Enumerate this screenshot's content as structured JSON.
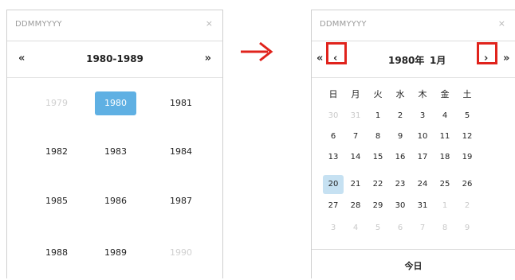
{
  "left_picker": {
    "input_placeholder": "DDMMYYYY",
    "clear": "×",
    "prev": "«",
    "next": "»",
    "decade_title": "1980-1989",
    "years": [
      "1979",
      "1980",
      "1981",
      "1982",
      "1983",
      "1984",
      "1985",
      "1986",
      "1987",
      "1988",
      "1989",
      "1990"
    ],
    "selected_year": "1980"
  },
  "right_picker": {
    "input_placeholder": "DDMMYYYY",
    "clear": "×",
    "prev_year": "«",
    "prev_month": "‹",
    "next_month": "›",
    "next_year": "»",
    "year_label": "1980年",
    "month_label": "1月",
    "weekdays": [
      "日",
      "月",
      "火",
      "水",
      "木",
      "金",
      "土"
    ],
    "days": [
      [
        "30",
        "31",
        "1",
        "2",
        "3",
        "4",
        "5"
      ],
      [
        "6",
        "7",
        "8",
        "9",
        "10",
        "11",
        "12"
      ],
      [
        "13",
        "14",
        "15",
        "16",
        "17",
        "18",
        "19"
      ],
      [
        "20",
        "21",
        "22",
        "23",
        "24",
        "25",
        "26"
      ],
      [
        "27",
        "28",
        "29",
        "30",
        "31",
        "1",
        "2"
      ],
      [
        "3",
        "4",
        "5",
        "6",
        "7",
        "8",
        "9"
      ]
    ],
    "selected_day": "20",
    "today_label": "今日"
  },
  "colors": {
    "selected_year_bg": "#5fb0e3",
    "selected_day_bg": "#c6e1f2",
    "highlight": "#e0231c",
    "arrow": "#e0231c"
  }
}
